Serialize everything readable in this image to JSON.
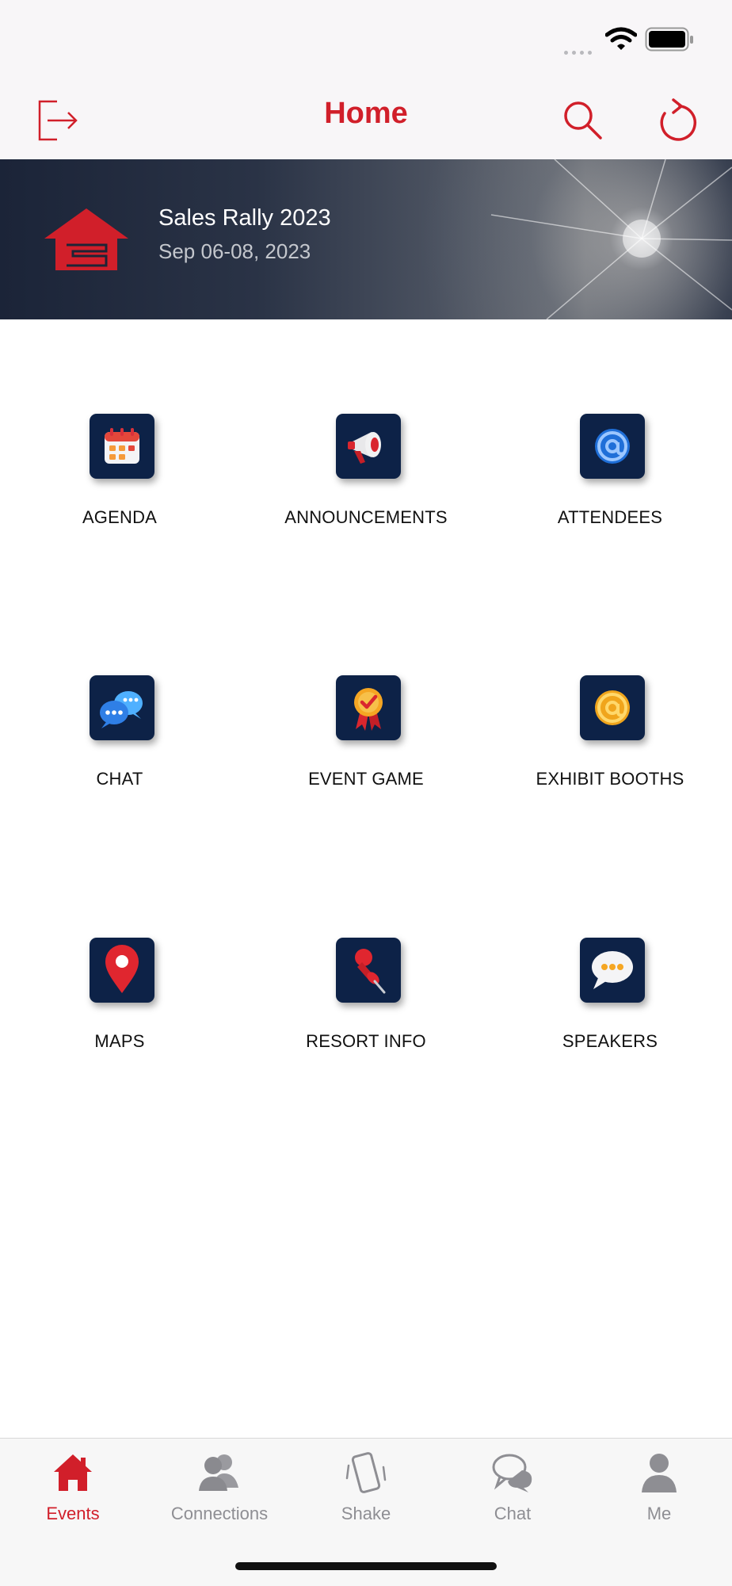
{
  "status_bar": {
    "signal_icon": "signal-dots-icon",
    "wifi_icon": "wifi-icon",
    "battery_icon": "battery-icon"
  },
  "nav": {
    "title": "Home",
    "left_icon": "logout-icon",
    "right_icons": [
      "search-icon",
      "refresh-icon"
    ],
    "accent_color": "#d11f2a"
  },
  "event": {
    "title": "Sales Rally 2023",
    "dates": "Sep 06-08, 2023",
    "logo_icon": "house-logo-icon"
  },
  "tiles": [
    {
      "label": "AGENDA",
      "icon": "calendar-icon"
    },
    {
      "label": "ANNOUNCEMENTS",
      "icon": "megaphone-icon"
    },
    {
      "label": "ATTENDEES",
      "icon": "at-sign-icon"
    },
    {
      "label": "CHAT",
      "icon": "chat-bubbles-icon"
    },
    {
      "label": "EVENT GAME",
      "icon": "award-ribbon-icon"
    },
    {
      "label": "EXHIBIT BOOTHS",
      "icon": "at-sign-gold-icon"
    },
    {
      "label": "MAPS",
      "icon": "map-pin-icon"
    },
    {
      "label": "RESORT INFO",
      "icon": "push-pin-icon"
    },
    {
      "label": "SPEAKERS",
      "icon": "speech-bubble-icon"
    }
  ],
  "tabbar": {
    "active": "Events",
    "tabs": [
      {
        "label": "Events",
        "icon": "home-icon"
      },
      {
        "label": "Connections",
        "icon": "people-icon"
      },
      {
        "label": "Shake",
        "icon": "shake-phone-icon"
      },
      {
        "label": "Chat",
        "icon": "chat-icon"
      },
      {
        "label": "Me",
        "icon": "person-icon"
      }
    ]
  },
  "colors": {
    "tile_background": "#0d2247",
    "inactive_tab": "#8e8e93"
  }
}
